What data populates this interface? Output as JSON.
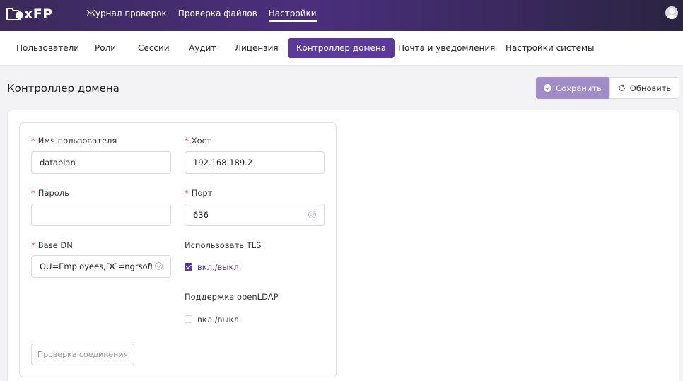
{
  "app": {
    "logo_text": "xFP",
    "nav": [
      {
        "label": "Журнал проверок"
      },
      {
        "label": "Проверка файлов"
      },
      {
        "label": "Настройки"
      }
    ]
  },
  "tabs": [
    {
      "label": "Пользователи"
    },
    {
      "label": "Роли"
    },
    {
      "label": "Сессии"
    },
    {
      "label": "Аудит"
    },
    {
      "label": "Лицензия"
    },
    {
      "label": "Контроллер домена"
    },
    {
      "label": "Почта и уведомления"
    },
    {
      "label": "Настройки системы"
    }
  ],
  "page": {
    "title": "Контроллер домена",
    "save_label": "Сохранить",
    "refresh_label": "Обновить"
  },
  "form": {
    "required_mark": "*",
    "username": {
      "label": "Имя пользователя",
      "value": "dataplan"
    },
    "host": {
      "label": "Хост",
      "value": "192.168.189.2"
    },
    "password": {
      "label": "Пароль",
      "value": ""
    },
    "port": {
      "label": "Порт",
      "value": "636"
    },
    "base_dn": {
      "label": "Base DN",
      "value": "OU=Employees,DC=ngrsoftlab,DC=ru"
    },
    "tls": {
      "label": "Использовать TLS",
      "toggle_label": "вкл./выкл.",
      "checked": true
    },
    "openldap": {
      "label": "Поддержка openLDAP",
      "toggle_label": "вкл./выкл.",
      "checked": false
    },
    "test_button": "Проверка соединения"
  },
  "colors": {
    "accent": "#5b3a9c",
    "save_button": "#a08cc6",
    "required": "#e0463a"
  }
}
